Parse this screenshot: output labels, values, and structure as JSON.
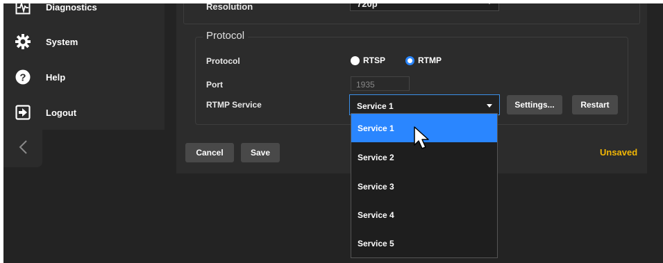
{
  "sidebar": {
    "items": [
      {
        "label": "Diagnostics",
        "icon": "diagnostics-icon"
      },
      {
        "label": "System",
        "icon": "gear-icon"
      },
      {
        "label": "Help",
        "icon": "help-icon"
      },
      {
        "label": "Logout",
        "icon": "logout-icon"
      }
    ],
    "collapse_icon": "chevron-left-icon"
  },
  "top_section": {
    "label": "Resolution",
    "value": "720p"
  },
  "protocol_section": {
    "legend": "Protocol",
    "protocol_label": "Protocol",
    "options": [
      {
        "label": "RTSP",
        "selected": false
      },
      {
        "label": "RTMP",
        "selected": true
      }
    ],
    "port_label": "Port",
    "port_value": "1935",
    "service_label": "RTMP Service",
    "service_value": "Service 1",
    "settings_button": "Settings...",
    "restart_button": "Restart"
  },
  "footer": {
    "cancel_button": "Cancel",
    "save_button": "Save",
    "status": "Unsaved"
  },
  "dropdown": {
    "options": [
      "Service 1",
      "Service 2",
      "Service 3",
      "Service 4",
      "Service 5"
    ],
    "selected_index": 0
  },
  "colors": {
    "accent": "#2a86ff",
    "status": "#f2b705",
    "background": "#232323",
    "panel": "#2c2c2c"
  }
}
